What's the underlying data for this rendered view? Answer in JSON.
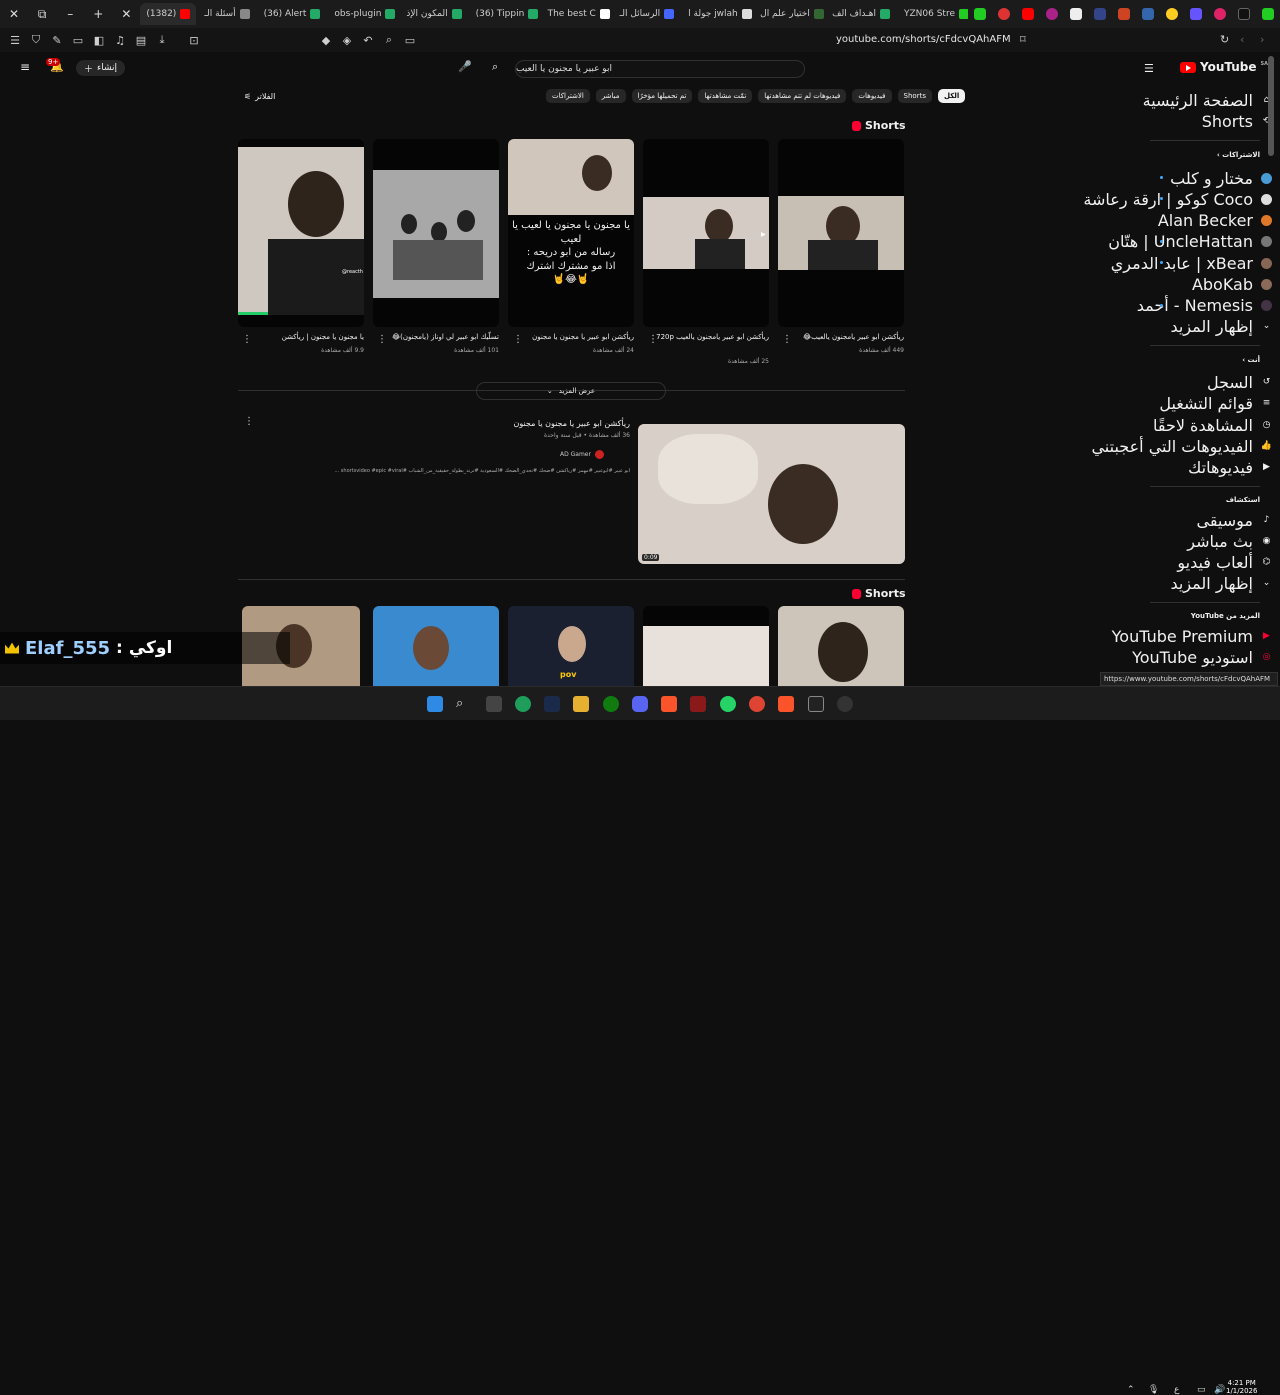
{
  "tabs": [
    {
      "label": "(1382)",
      "active": true,
      "color": "#ff0000"
    },
    {
      "label": "أسئلة الـ",
      "color": "#888888"
    },
    {
      "label": "(36) Alert",
      "color": "#22aa66"
    },
    {
      "label": "obs-plugin",
      "color": "#22aa66"
    },
    {
      "label": "المكون الإذ",
      "color": "#22aa66"
    },
    {
      "label": "(36) Tippin",
      "color": "#22aa66"
    },
    {
      "label": "The best C",
      "color": "#ffffff"
    },
    {
      "label": "الرسائل الـ",
      "color": "#4466ff"
    },
    {
      "label": "جولة ا jwlah",
      "color": "#dddddd"
    },
    {
      "label": "اختيار علم ال",
      "color": "#336633"
    },
    {
      "label": "اهـداف الف",
      "color": "#22aa66"
    },
    {
      "label": "YZN06 Stre",
      "color": "#22cc22"
    }
  ],
  "address_url": "youtube.com/shorts/cFdcvQAhAFM",
  "youtube": {
    "logo": "YouTube",
    "country": "SA",
    "search_value": "ابو عبير يا مجنون يا العيب",
    "create_label": "إنشاء",
    "notif_count": "9+",
    "filter_label": "الفلاتر",
    "filters": [
      "الكل",
      "Shorts",
      "فيديوهات",
      "فيديوهات لم تتم مشاهدتها",
      "تمّت مشاهدتها",
      "تم تحميلها مؤخرًا",
      "مباشر",
      "الاشتراكات"
    ]
  },
  "shorts_heading": "Shorts",
  "shorts": [
    {
      "title": "ريأكشن ابو عبير يامجنون يالعيب😂",
      "views": "449 ألف مشاهدة"
    },
    {
      "title": "ريأكشن ابو عبير يامجنون يالعيب 720p",
      "views": "25 ألف مشاهدة"
    },
    {
      "title": "ريأكشن ابو عبير يا مجنون يا مجنون",
      "views": "24 ألف مشاهدة",
      "overlay": "يا مجنون يا مجنون يا لعيب يا لعيب\nرساله من ابو دريحه :\nاذا مو مشترك اشترك\n🤘😂🤘"
    },
    {
      "title": "تسلّيك ابو عبير لي اوناز (يامجنون)😂",
      "views": "101 ألف مشاهدة"
    },
    {
      "title": "يا مجنون يا مجنون | ريأكشن",
      "views": "9.9 ألف مشاهدة"
    }
  ],
  "show_more": "عرض المزيد",
  "video": {
    "title": "ريأكشن ابو عبير يا مجنون يا مجنون",
    "meta": "36 ألف مشاهدة • قبل سنة واحدة",
    "channel": "AD Gamer",
    "desc": "ابو عبير #ابوعبير #مهمز #رياكشن #ضحك #تحدي_الضحك #السعودية #ترند_بطولة_حقيقية_من_الشباب #shortsvideo #epic #viral ...",
    "duration": "0:09"
  },
  "sidebar": {
    "home": "الصفحة الرئيسية",
    "shorts": "Shorts",
    "subs_head": "الاشتراكات",
    "subs": [
      {
        "name": "مختار و كلب",
        "color": "#4a9ad4",
        "live": true
      },
      {
        "name": "Coco كوكو | ارقة رعاشة",
        "color": "#dddddd",
        "live": true
      },
      {
        "name": "Alan Becker",
        "color": "#e0782a",
        "live": false
      },
      {
        "name": "UncleHattan | هتّان",
        "color": "#777777",
        "live": true
      },
      {
        "name": "xBear | عابد الدمري",
        "color": "#886655",
        "live": true
      },
      {
        "name": "AboKab",
        "color": "#8a6a58",
        "live": false
      },
      {
        "name": "Nemesis - أحمد",
        "color": "#443344",
        "live": true
      }
    ],
    "show_more_subs": "إظهار المزيد",
    "you_head": "أنت",
    "you_items": [
      "السجل",
      "قوائم التشغيل",
      "المشاهدة لاحقًا",
      "الفيديوهات التي أعجبتني",
      "فيديوهاتك"
    ],
    "explore_head": "استكشاف",
    "explore_items": [
      "موسيقى",
      "بث مباشر",
      "ألعاب فيديو",
      "إظهار المزيد"
    ],
    "more_head": "المزيد من YouTube",
    "more_items": [
      "YouTube Premium",
      "استوديو YouTube"
    ]
  },
  "chat": {
    "user": "Elaf_555",
    "sep": ":",
    "message": "اوكي"
  },
  "status_url": "https://www.youtube.com/shorts/cFdcvQAhAFM",
  "clock": {
    "time": "4:21 PM",
    "date": "1/1/2026"
  },
  "lang_indicator": "ع"
}
